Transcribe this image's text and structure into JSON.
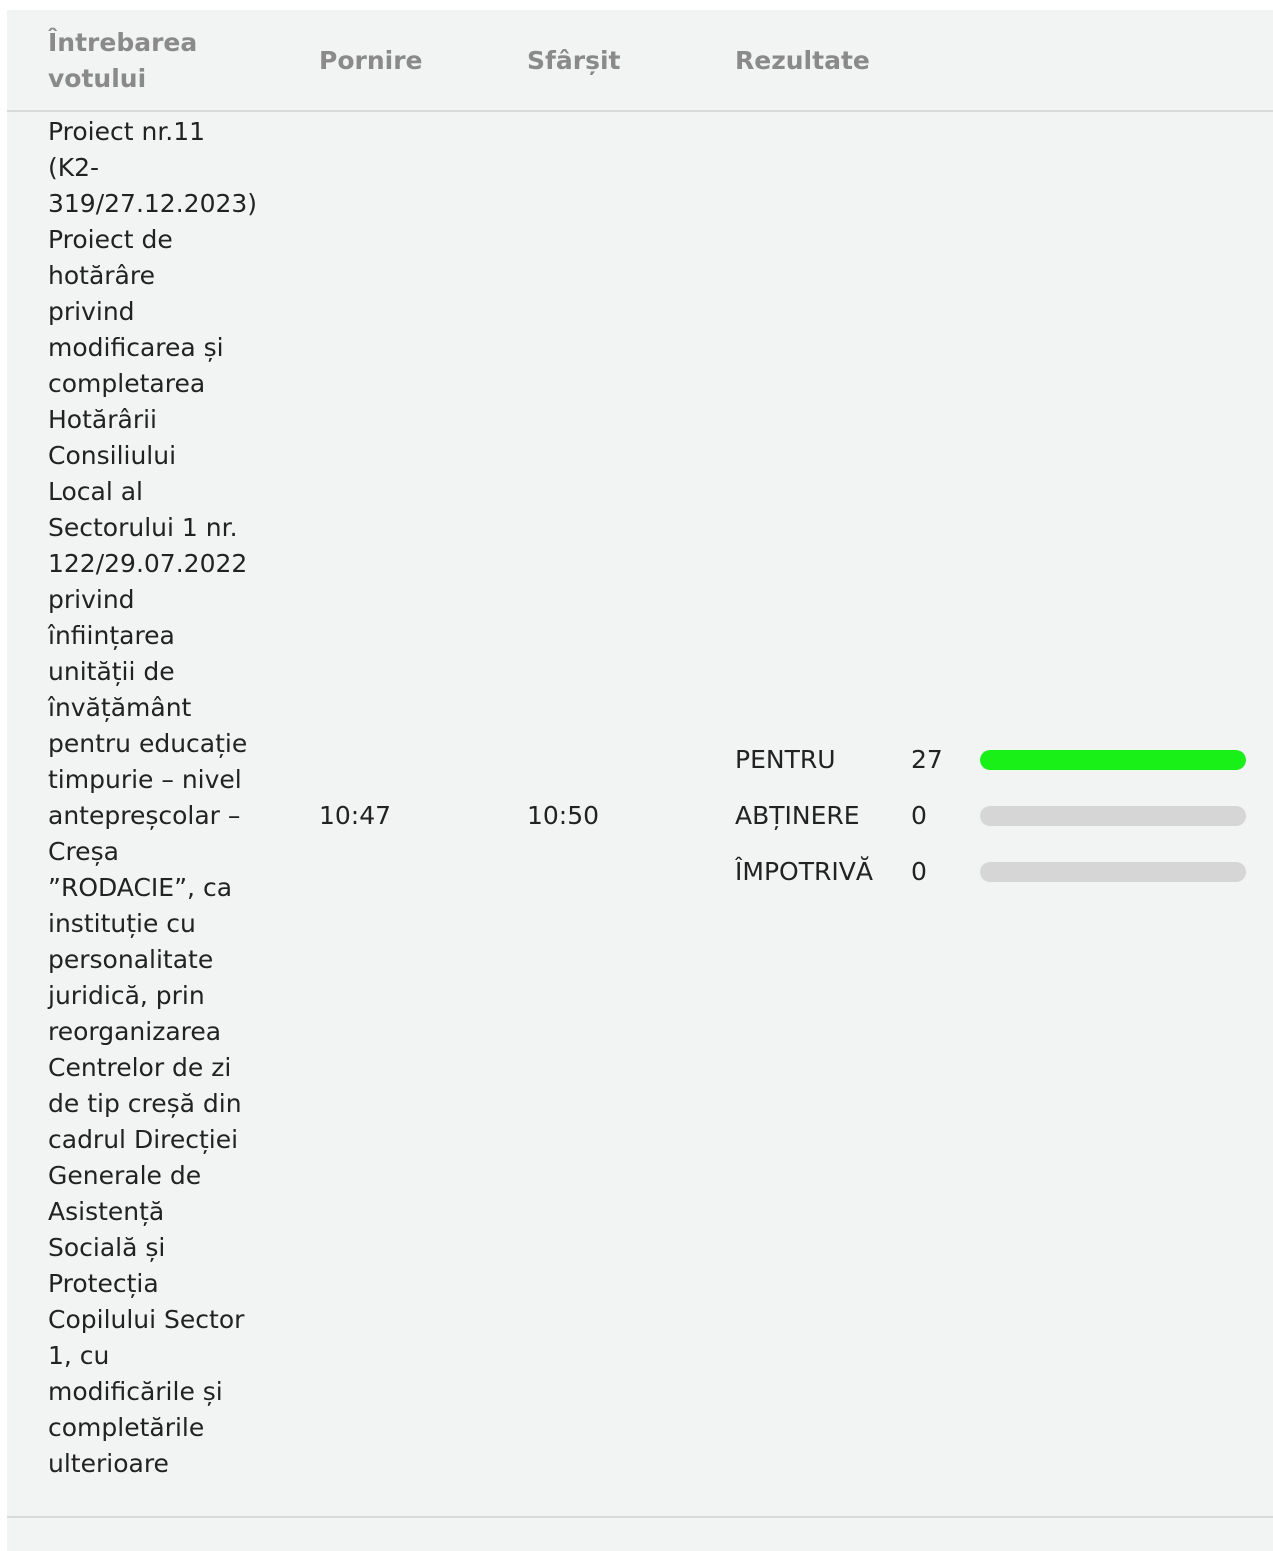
{
  "table": {
    "headers": {
      "question": "Întrebarea votului",
      "start": "Pornire",
      "end": "Sfârșit",
      "results": "Rezultate"
    },
    "rows": [
      {
        "question": "Proiect nr.11 (K2-319/27.12.2023) Proiect de hotărâre privind modificarea și completarea Hotărârii Consiliului Local al Sectorului 1 nr. 122/29.07.2022 privind înființarea unității de învățământ pentru educație timpurie – nivel antepreșcolar – Creșa ”RODACIE”, ca instituție cu personalitate juridică, prin reorganizarea Centrelor de zi de tip creșă din cadrul Direcției Generale de Asistență Socială și Protecția Copilului Sector 1, cu modificările și completările ulterioare",
        "start": "10:47",
        "end": "10:50",
        "results": [
          {
            "label": "PENTRU",
            "count": "27",
            "fraction": 1.0,
            "color": "#18f018"
          },
          {
            "label": "ABȚINERE",
            "count": "0",
            "fraction": 0.0,
            "color": "#18f018"
          },
          {
            "label": "ÎMPOTRIVĂ",
            "count": "0",
            "fraction": 0.0,
            "color": "#18f018"
          }
        ]
      }
    ]
  },
  "colors": {
    "panel_background": "#f2f3f3",
    "header_text": "#8a8a8a",
    "body_text": "#222222",
    "bar_track": "#d6d6d6",
    "bar_fill": "#18f018"
  }
}
